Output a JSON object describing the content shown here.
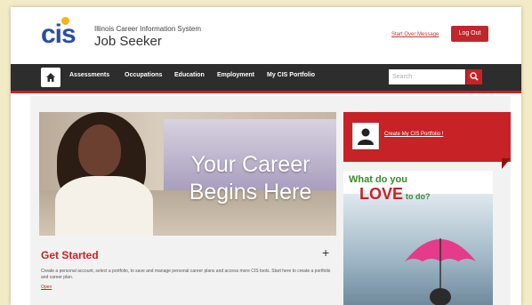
{
  "header": {
    "logo": "cis",
    "system_name": "Illinois Career Information System",
    "app_name": "Job Seeker",
    "link": "Start Over Message",
    "logout_label": "Log Out"
  },
  "nav": {
    "home_icon": "home-icon",
    "items": [
      "Assessments",
      "Occupations",
      "Education",
      "Employment",
      "My CIS Portfolio"
    ],
    "search_placeholder": "Search",
    "search_icon": "search-icon"
  },
  "hero": {
    "line1": "Your Career",
    "line2": "Begins Here"
  },
  "get_started": {
    "title": "Get Started",
    "expand_icon": "plus-icon",
    "description": "Create a personal account, select a portfolio, to save and manage personal career plans and access more CIS tools. Start here to create a portfolio and career plan.",
    "more": "Open"
  },
  "portfolio": {
    "avatar_icon": "user-icon",
    "link": "Create My CIS Portfolio !"
  },
  "promo": {
    "line1": "What do you",
    "love": "LOVE",
    "line2_rest": "to do?"
  },
  "colors": {
    "accent": "#c72226",
    "nav_bg": "#2d2d2d",
    "page_bg": "#f3ebc6",
    "green": "#3a8a2e"
  }
}
